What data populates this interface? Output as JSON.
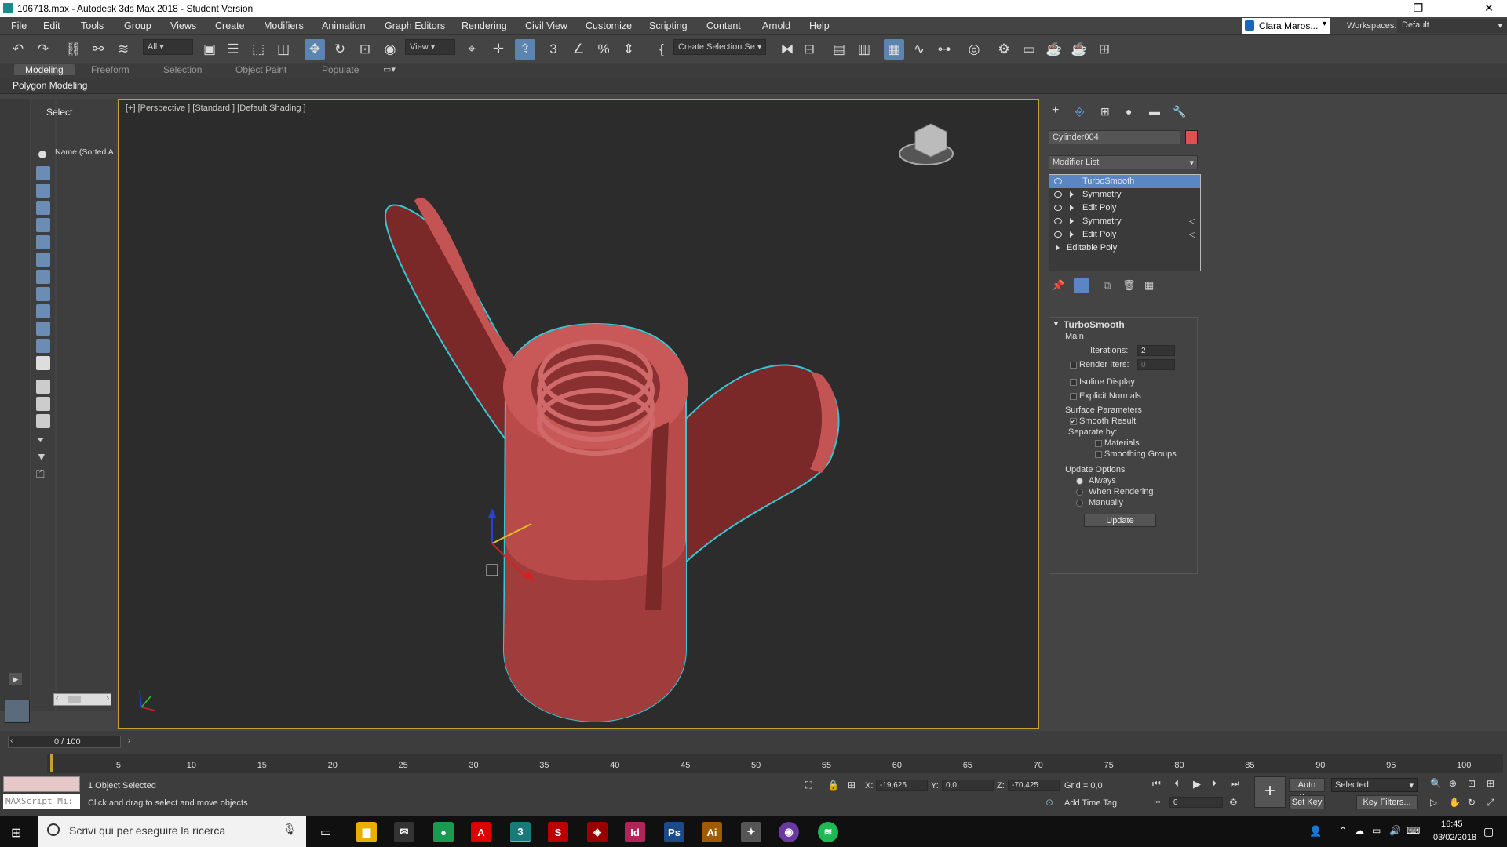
{
  "window": {
    "title": "106718.max - Autodesk 3ds Max 2018 - Student Version"
  },
  "menu": [
    "File",
    "Edit",
    "Tools",
    "Group",
    "Views",
    "Create",
    "Modifiers",
    "Animation",
    "Graph Editors",
    "Rendering",
    "Civil View",
    "Customize",
    "Scripting",
    "Content",
    "Arnold",
    "Help"
  ],
  "user": {
    "name": "Clara Maros...",
    "workspaces_label": "Workspaces:",
    "workspace": "Default"
  },
  "toolbar": {
    "filter": "All",
    "coord": "View",
    "selection_set": "Create Selection Se"
  },
  "ribbon": {
    "tabs": [
      "Modeling",
      "Freeform",
      "Selection",
      "Object Paint",
      "Populate"
    ],
    "active": "Modeling",
    "sub": "Polygon Modeling"
  },
  "scene": {
    "select": "Select",
    "name_col": "Name (Sorted A"
  },
  "viewport": {
    "label": "[+] [Perspective ] [Standard ] [Default Shading ]"
  },
  "command_panel": {
    "object_name": "Cylinder004",
    "object_color": "#e05050",
    "modifier_list_label": "Modifier List",
    "stack": [
      {
        "label": "TurboSmooth",
        "selected": true,
        "eye": true,
        "expand": false
      },
      {
        "label": "Symmetry",
        "selected": false,
        "eye": true,
        "expand": true
      },
      {
        "label": "Edit Poly",
        "selected": false,
        "eye": true,
        "expand": true
      },
      {
        "label": "Symmetry",
        "selected": false,
        "eye": true,
        "expand": true
      },
      {
        "label": "Edit Poly",
        "selected": false,
        "eye": true,
        "expand": true
      },
      {
        "label": "Editable Poly",
        "selected": false,
        "eye": false,
        "expand": true
      }
    ],
    "turbosmooth": {
      "title": "TurboSmooth",
      "main": "Main",
      "iterations_label": "Iterations:",
      "iterations": "2",
      "render_iters_label": "Render Iters:",
      "render_iters": "0",
      "isoline": "Isoline Display",
      "explicit": "Explicit Normals",
      "surface": "Surface Parameters",
      "smooth_result": "Smooth Result",
      "separate_by": "Separate by:",
      "materials": "Materials",
      "smoothing_groups": "Smoothing Groups",
      "update_options": "Update Options",
      "always": "Always",
      "when_rendering": "When Rendering",
      "manually": "Manually",
      "update_btn": "Update"
    }
  },
  "timeline": {
    "frame": "0 / 100",
    "ticks": [
      "5",
      "10",
      "15",
      "20",
      "25",
      "30",
      "35",
      "40",
      "45",
      "50",
      "55",
      "60",
      "65",
      "70",
      "75",
      "80",
      "85",
      "90",
      "95",
      "100"
    ]
  },
  "status": {
    "selected": "1 Object Selected",
    "hint": "Click and drag to select and move objects",
    "script": "MAXScript Mi:",
    "x_label": "X:",
    "x": "-19,625",
    "y_label": "Y:",
    "y": "0,0",
    "z_label": "Z:",
    "z": "-70,425",
    "grid": "Grid = 0,0",
    "add_time_tag": "Add Time Tag",
    "auto_key": "Auto Key",
    "set_key": "Set Key",
    "selected_dd": "Selected",
    "key_filters": "Key Filters...",
    "frame_field": "0"
  },
  "taskbar": {
    "search": "Scrivi qui per eseguire la ricerca",
    "time": "16:45",
    "date": "03/02/2018"
  }
}
